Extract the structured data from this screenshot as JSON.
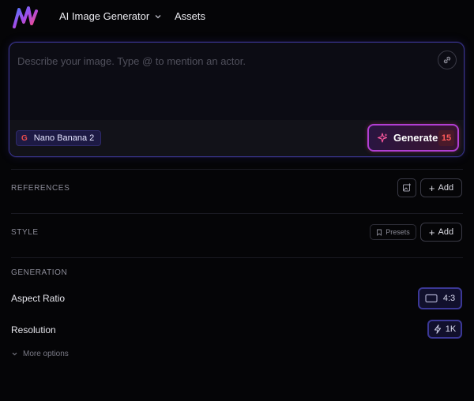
{
  "topbar": {
    "generator_label": "AI Image Generator",
    "assets_label": "Assets"
  },
  "prompt": {
    "placeholder": "Describe your image. Type @ to mention an actor.",
    "value": ""
  },
  "model": {
    "icon_letter": "G",
    "name": "Nano Banana 2"
  },
  "generate": {
    "label": "Generate",
    "credits": "15"
  },
  "references": {
    "label": "REFERENCES",
    "add_label": "Add"
  },
  "style": {
    "label": "STYLE",
    "presets_label": "Presets",
    "add_label": "Add"
  },
  "generation": {
    "label": "GENERATION",
    "aspect_ratio_label": "Aspect Ratio",
    "aspect_ratio_value": "4:3",
    "resolution_label": "Resolution",
    "resolution_value": "1K",
    "more_options_label": "More options"
  },
  "colors": {
    "accent": "#3b3896",
    "generate_border": "#b13ed3",
    "credit_text": "#ff5a5a"
  }
}
